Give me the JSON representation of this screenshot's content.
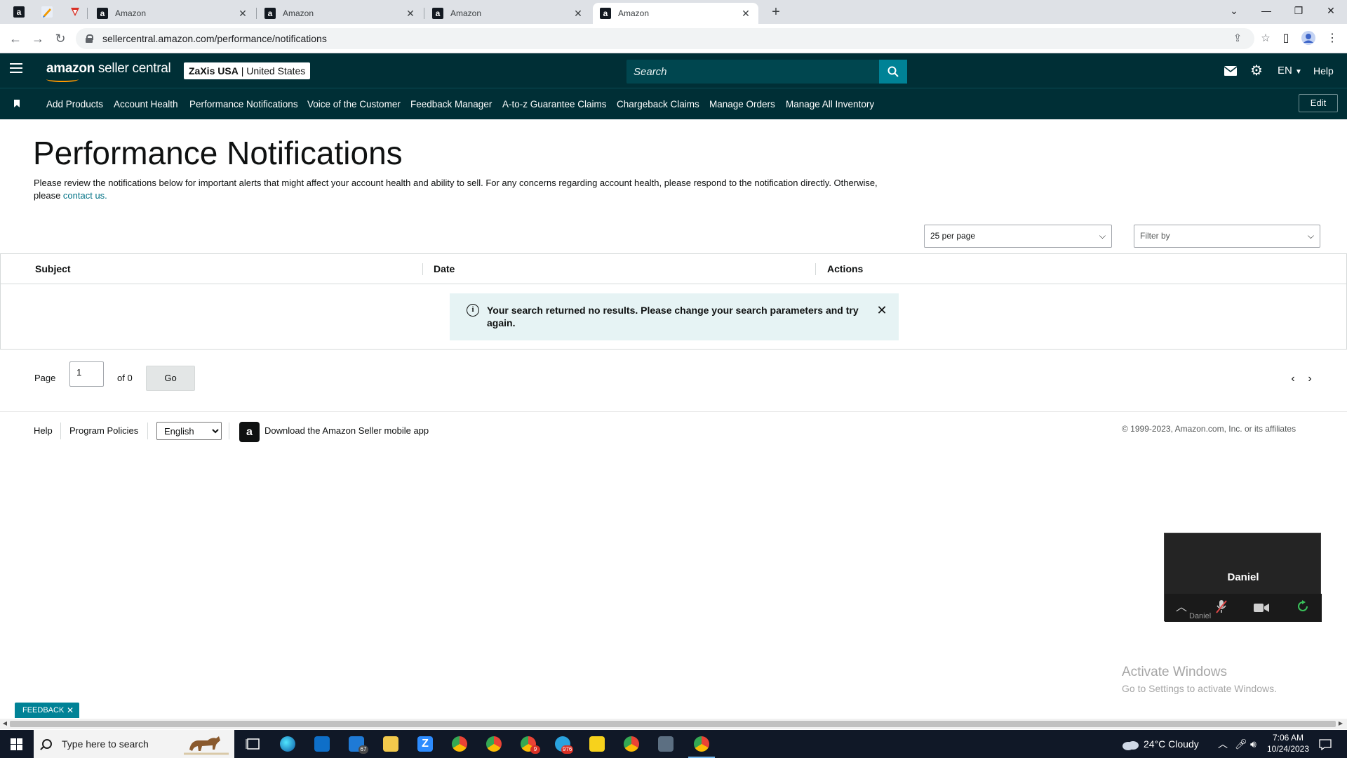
{
  "browser": {
    "tabs": [
      {
        "title": "Amazon"
      },
      {
        "title": "Amazon"
      },
      {
        "title": "Amazon"
      },
      {
        "title": "Amazon"
      }
    ],
    "url": "sellercentral.amazon.com/performance/notifications"
  },
  "header": {
    "logo_brand": "amazon",
    "logo_suffix": " seller central",
    "account_name": "ZaXis USA",
    "account_region": " | United States",
    "search_placeholder": "Search",
    "language": "EN",
    "help": "Help"
  },
  "nav": {
    "items": [
      {
        "label": "Add Products"
      },
      {
        "label": "Account Health"
      },
      {
        "label": "Performance Notifications"
      },
      {
        "label": "Voice of the Customer"
      },
      {
        "label": "Feedback Manager"
      },
      {
        "label": "A-to-z Guarantee Claims"
      },
      {
        "label": "Chargeback Claims"
      },
      {
        "label": "Manage Orders"
      },
      {
        "label": "Manage All Inventory"
      }
    ],
    "edit_label": "Edit"
  },
  "page": {
    "title": "Performance Notifications",
    "intro_text": "Please review the notifications below for important alerts that might affect your account health and ability to sell. For any concerns regarding account health, please respond to the notification directly. Otherwise, please ",
    "intro_link": "contact us."
  },
  "controls": {
    "per_page": "25 per page",
    "filter_placeholder": "Filter by"
  },
  "table": {
    "columns": [
      "Subject",
      "Date",
      "Actions"
    ],
    "rows": [],
    "empty_message": "Your search returned no results. Please change your search parameters and try again."
  },
  "pagination": {
    "page_label": "Page",
    "current_page": "1",
    "of_label": "of 0",
    "go_label": "Go"
  },
  "footer": {
    "help": "Help",
    "program_policies": "Program Policies",
    "language_selected": "English",
    "app_download": "Download the Amazon Seller mobile app",
    "copyright": "© 1999-2023, Amazon.com, Inc. or its affiliates"
  },
  "call_widget": {
    "name": "Daniel",
    "subname": "Daniel"
  },
  "overlay": {
    "activate_title": "Activate Windows",
    "activate_subtitle": "Go to Settings to activate Windows.",
    "feedback_label": "FEEDBACK"
  },
  "taskbar": {
    "search_placeholder": "Type here to search",
    "mail_badge": "67",
    "chrome_badge": "9",
    "telegram_badge": "976",
    "weather": "24°C  Cloudy",
    "time": "7:06 AM",
    "date": "10/24/2023"
  },
  "colors": {
    "header_bg": "#002f36",
    "search_btn": "#008296",
    "link": "#007185",
    "alert_bg": "#e6f3f4"
  }
}
